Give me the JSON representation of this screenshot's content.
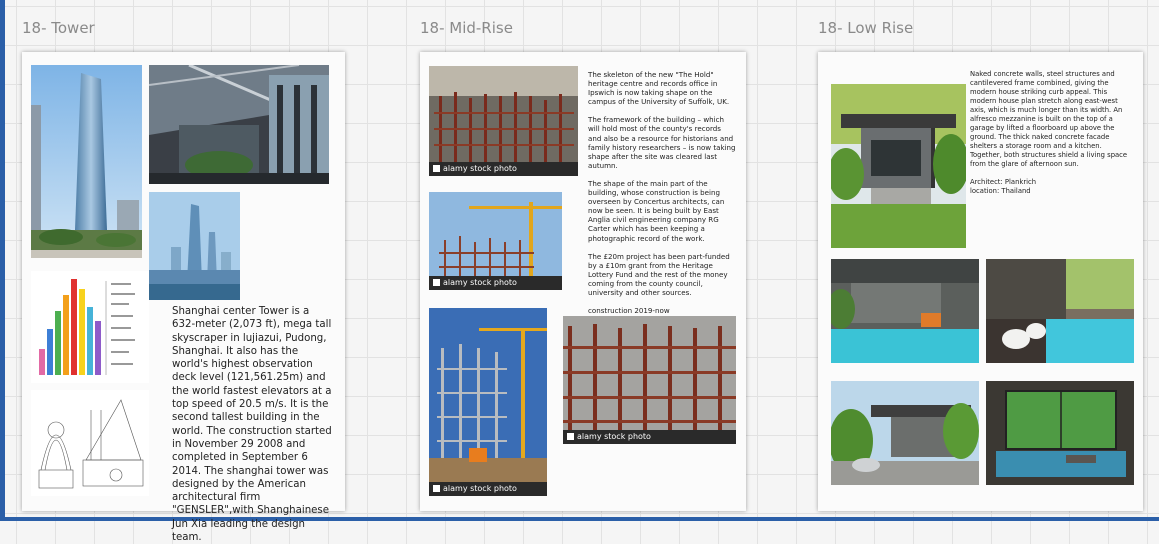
{
  "sections": [
    {
      "title": "18- Tower"
    },
    {
      "title": "18- Mid-Rise"
    },
    {
      "title": "18- Low Rise"
    }
  ],
  "tower": {
    "description": "Shanghai center Tower is a 632-meter (2,073 ft), mega tall skyscraper in lujiazui, Pudong, Shanghai. It also has the world's highest observation deck level (121,561.25m) and the world fastest elevators at a top speed of 20.5 m/s. It is the second tallest building in the world. The construction started in November 29 2008 and completed in September 6 2014. The shanghai tower was designed by the American architectural firm \"GENSLER\",with Shanghainese Jun Xia leading the design team."
  },
  "midrise": {
    "paragraphs": [
      "The skeleton of the new \"The Hold\" heritage centre and records office in Ipswich is now taking shape on the campus of the University of Suffolk, UK.",
      "The framework of the building – which will hold most of the county's records and also be a resource for historians and family history researchers – is now taking shape after the site was cleared last autumn.",
      "The shape of the main part of the building, whose construction is being overseen by Concertus architects, can now be seen. It is being built by East Anglia civil engineering company RG Carter which has been keeping a photographic record of the work.",
      "The £20m project has been part-funded by a £10m grant from the Heritage Lottery Fund and the rest of the money coming from the county council, university and other sources.",
      "construction 2019-now"
    ],
    "watermark": "alamy stock photo"
  },
  "lowrise": {
    "description": "Naked concrete walls, steel structures and cantilevered frame combined, giving the modern house striking curb appeal. This modern house plan stretch along east-west axis, which is much longer than its width. An alfresco mezzanine is built on the top of a garage by lifted a floorboard up above the ground. The thick naked concrete facade shelters a storage room and a kitchen. Together, both structures shield a living space from the glare of afternoon sun.",
    "architect": "Architect: Plankrich",
    "location": "location: Thailand"
  },
  "colors": {
    "frame": "#2b5fa8",
    "card": "#fbfbfb",
    "title": "#8a8a8a"
  }
}
